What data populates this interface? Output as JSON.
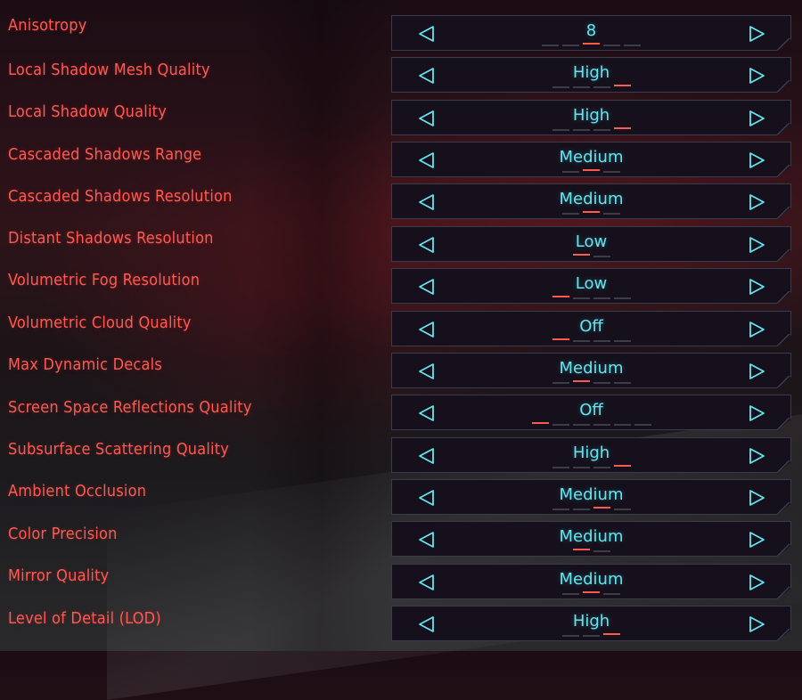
{
  "settings": [
    {
      "label": "Anisotropy",
      "value": "8",
      "ticks": 5,
      "active": 2
    },
    {
      "label": "Local Shadow Mesh Quality",
      "value": "High",
      "ticks": 4,
      "active": 3
    },
    {
      "label": "Local Shadow Quality",
      "value": "High",
      "ticks": 4,
      "active": 3
    },
    {
      "label": "Cascaded Shadows Range",
      "value": "Medium",
      "ticks": 3,
      "active": 1
    },
    {
      "label": "Cascaded Shadows Resolution",
      "value": "Medium",
      "ticks": 3,
      "active": 1
    },
    {
      "label": "Distant Shadows Resolution",
      "value": "Low",
      "ticks": 2,
      "active": 0
    },
    {
      "label": "Volumetric Fog Resolution",
      "value": "Low",
      "ticks": 4,
      "active": 0
    },
    {
      "label": "Volumetric Cloud Quality",
      "value": "Off",
      "ticks": 4,
      "active": 0
    },
    {
      "label": "Max Dynamic Decals",
      "value": "Medium",
      "ticks": 4,
      "active": 1
    },
    {
      "label": "Screen Space Reflections Quality",
      "value": "Off",
      "ticks": 6,
      "active": 0
    },
    {
      "label": "Subsurface Scattering Quality",
      "value": "High",
      "ticks": 4,
      "active": 3
    },
    {
      "label": "Ambient Occlusion",
      "value": "Medium",
      "ticks": 4,
      "active": 2
    },
    {
      "label": "Color Precision",
      "value": "Medium",
      "ticks": 2,
      "active": 0
    },
    {
      "label": "Mirror Quality",
      "value": "Medium",
      "ticks": 3,
      "active": 1
    },
    {
      "label": "Level of Detail (LOD)",
      "value": "High",
      "ticks": 3,
      "active": 2
    }
  ],
  "icons": {
    "left": "triangle-left-outline",
    "right": "triangle-right-outline"
  },
  "colors": {
    "label": "#ff5a52",
    "value": "#64e5ee",
    "tick_active": "#ff5a52",
    "tick_inactive": "#3c3d48",
    "panel_border": "#3a3b4c"
  }
}
